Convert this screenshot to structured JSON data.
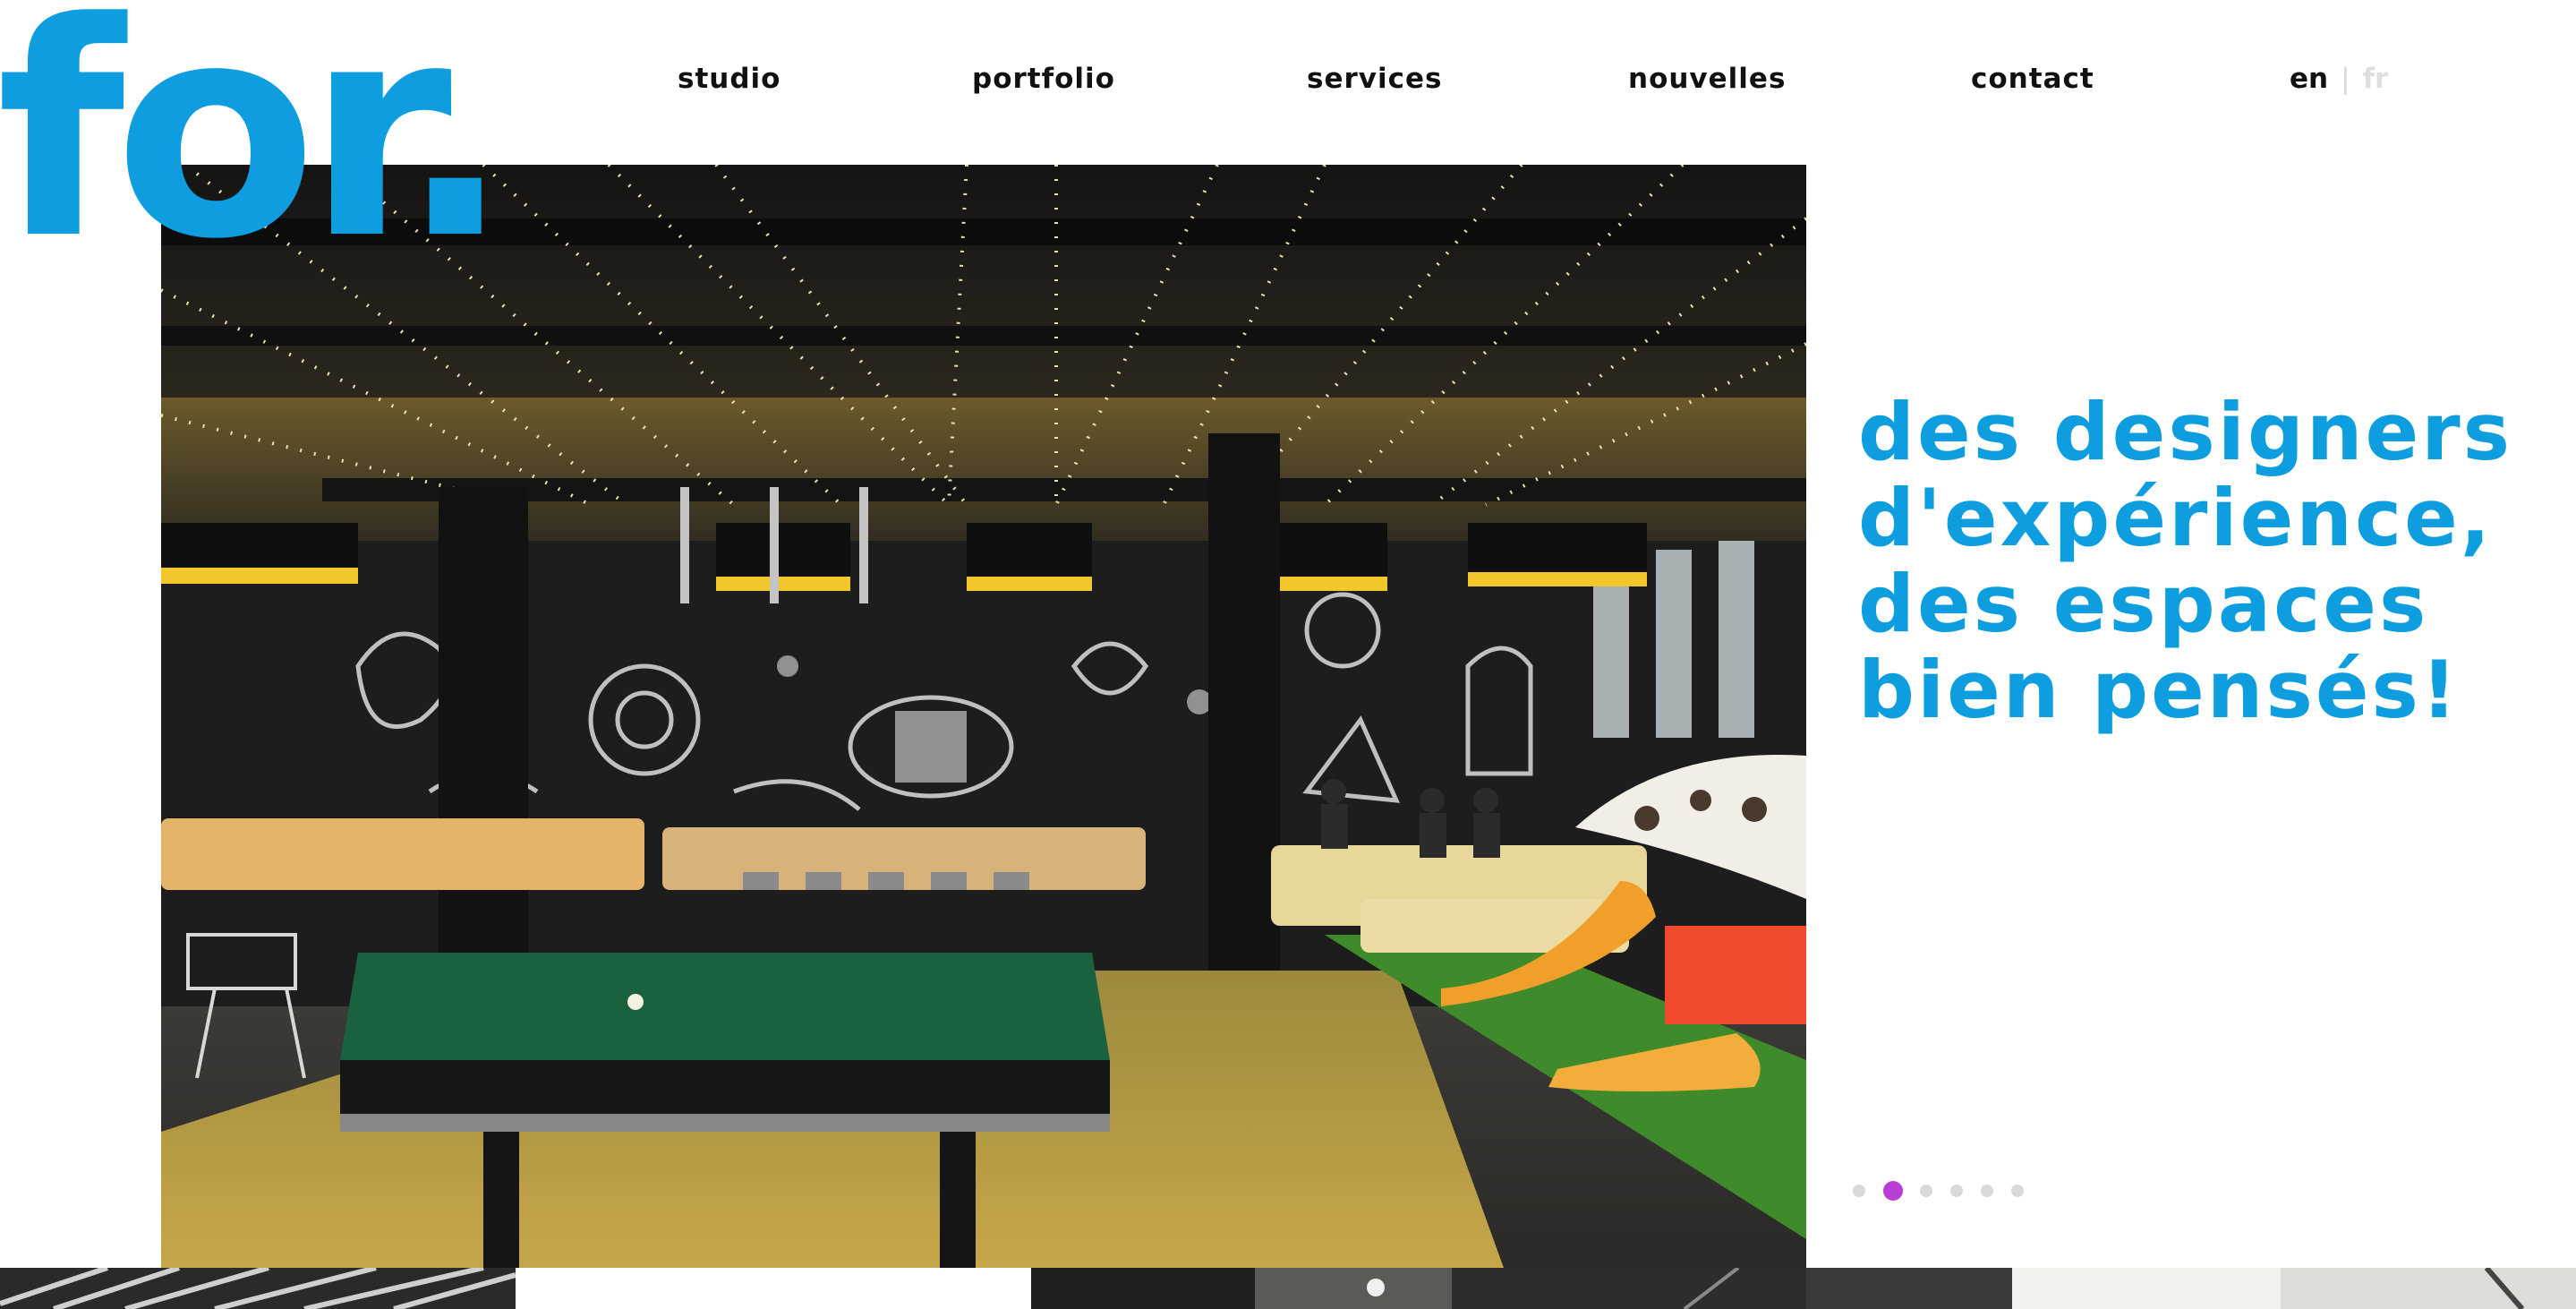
{
  "brand": {
    "logo_text": "for.",
    "color": "#0e9ee0"
  },
  "nav": {
    "items": [
      {
        "label": "studio"
      },
      {
        "label": "portfolio"
      },
      {
        "label": "services"
      },
      {
        "label": "nouvelles"
      },
      {
        "label": "contact"
      }
    ],
    "languages": {
      "current": "en",
      "separator": "|",
      "other": "fr"
    }
  },
  "hero": {
    "image": "lounge-with-pool-table",
    "tagline_lines": [
      "des designers",
      "d'expérience,",
      "des espaces",
      "bien pensés!"
    ]
  },
  "slider": {
    "count": 6,
    "active_index": 1,
    "active_color": "#b83fd6",
    "inactive_color": "#d9d9d9"
  },
  "thumbnails": [
    {
      "name": "thumbnail-1"
    },
    {
      "name": "thumbnail-2"
    },
    {
      "name": "thumbnail-3"
    },
    {
      "name": "thumbnail-4"
    },
    {
      "name": "thumbnail-5"
    }
  ]
}
